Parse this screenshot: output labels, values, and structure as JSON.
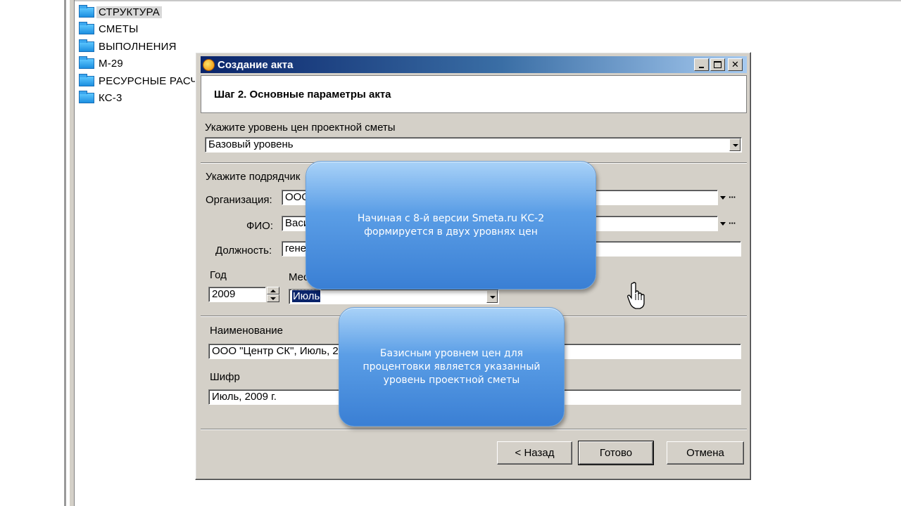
{
  "tree": {
    "items": [
      {
        "label": "СТРУКТУРА",
        "selected": true
      },
      {
        "label": "СМЕТЫ"
      },
      {
        "label": "ВЫПОЛНЕНИЯ"
      },
      {
        "label": "М-29"
      },
      {
        "label": "РЕСУРСНЫЕ РАСЧ"
      },
      {
        "label": "КС-3"
      }
    ]
  },
  "dialog": {
    "title": "Создание акта",
    "step_title": "Шаг 2. Основные параметры акта",
    "price_level_label": "Укажите уровень цен проектной сметы",
    "price_level_value": "Базовый уровень",
    "contractor_label": "Укажите подрядчик",
    "org_label": "Организация:",
    "org_value": "ООО",
    "fio_label": "ФИО:",
    "fio_value": "Васи",
    "position_label": "Должность:",
    "position_value": "гене",
    "year_label": "Год",
    "year_value": "2009",
    "month_label": "Мес",
    "month_value": "Июль",
    "name_label": "Наименование",
    "name_value": "ООО \"Центр СК\", Июль, 2009 г.",
    "code_label": "Шифр",
    "code_value": "Июль, 2009 г.",
    "back_button": "< Назад",
    "done_button": "Готово",
    "cancel_button": "Отмена",
    "ellipsis": "···"
  },
  "callouts": {
    "first": "Начиная с 8-й версии Smeta.ru КС-2\nформируется в двух уровнях цен",
    "second": "Базисным уровнем цен для\nпроцентовки является указанный\nуровень проектной сметы"
  },
  "colors": {
    "titlebar_start": "#0a246a",
    "titlebar_end": "#a6caf0",
    "dialog_bg": "#d4d0c8",
    "callout": "#3a7fd4"
  },
  "icons": {
    "folder": "folder-icon",
    "app": "app-icon",
    "cursor": "hand-cursor-icon"
  }
}
